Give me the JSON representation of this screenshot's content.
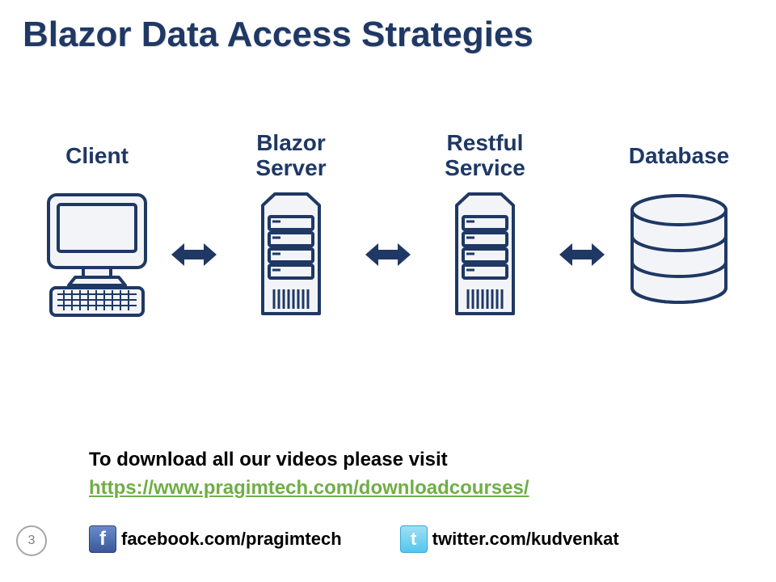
{
  "title": "Blazor Data Access Strategies",
  "nodes": {
    "client": "Client",
    "blazor_server": "Blazor\nServer",
    "restful_service": "Restful\nService",
    "database": "Database"
  },
  "footer": {
    "text": "To download all our videos please visit",
    "link": "https://www.pragimtech.com/downloadcourses/"
  },
  "social": {
    "facebook": "facebook.com/pragimtech",
    "twitter": "twitter.com/kudvenkat"
  },
  "page_number": "3",
  "colors": {
    "stroke": "#1f3864",
    "fill": "#f2f4f8",
    "arrow": "#1f3864"
  }
}
